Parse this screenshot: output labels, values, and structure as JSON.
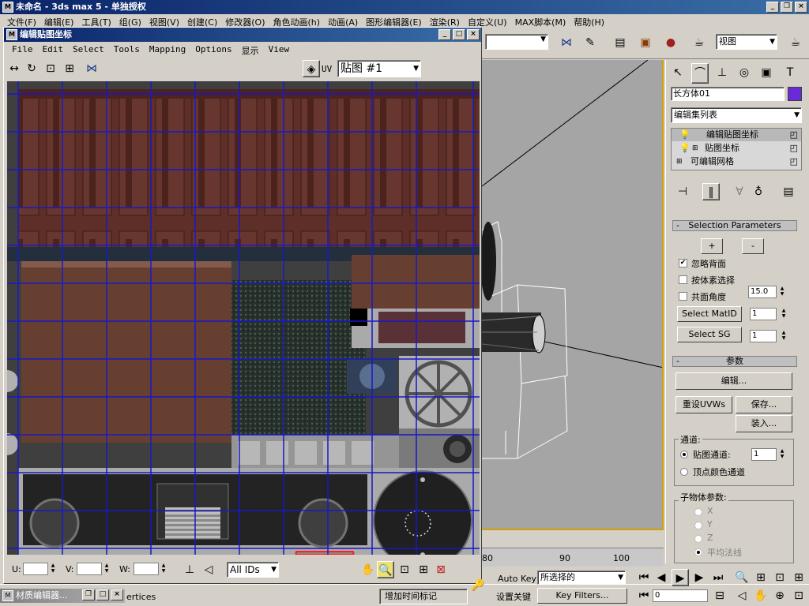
{
  "app": {
    "title": "未命名 - 3ds max 5 - 单独授权",
    "menu": [
      "文件(F)",
      "编辑(E)",
      "工具(T)",
      "组(G)",
      "视图(V)",
      "创建(C)",
      "修改器(O)",
      "角色动画(h)",
      "动画(A)",
      "图形编辑器(E)",
      "渲染(R)",
      "自定义(U)",
      "MAX脚本(M)",
      "帮助(H)"
    ]
  },
  "toolbar": {
    "view_dropdown": "视图"
  },
  "uvw_editor": {
    "title": "编辑贴图坐标",
    "menu": [
      "File",
      "Edit",
      "Select",
      "Tools",
      "Mapping",
      "Options",
      "显示",
      "View"
    ],
    "uv_label": "UV",
    "map_dropdown": "贴图 #1",
    "u_label": "U:",
    "v_label": "V:",
    "w_label": "W:",
    "ids_dropdown": "All IDs"
  },
  "command_panel": {
    "object_name": "长方体01",
    "modifier_list_label": "编辑集列表",
    "stack": [
      {
        "label": "编辑贴图坐标",
        "selected": true
      },
      {
        "label": "贴图坐标",
        "selected": false
      },
      {
        "label": "可编辑网格",
        "selected": false
      }
    ],
    "selection_params": {
      "title": "Selection Parameters",
      "plus": "+",
      "minus": "-",
      "ignore_backface": "忽略背面",
      "select_by_element": "按体素选择",
      "planar_angle": "共面角度",
      "planar_angle_value": "15.0",
      "select_matid": "Select MatID",
      "select_matid_value": "1",
      "select_sg": "Select SG",
      "select_sg_value": "1"
    },
    "params": {
      "title": "参数",
      "edit": "编辑...",
      "reset": "重设UVWs",
      "save": "保存...",
      "load": "装入...",
      "channel_group": "通道:",
      "map_channel": "贴图通道:",
      "map_channel_value": "1",
      "vertex_color": "顶点颜色通道",
      "subobj_group": "子物体参数:",
      "axis_x": "X",
      "axis_y": "Y",
      "axis_z": "Z",
      "avg_normals": "平均法线"
    },
    "minus_label": "-"
  },
  "timeline": {
    "ticks": [
      "80",
      "90",
      "100"
    ]
  },
  "status": {
    "material_editor": "材质编辑器...",
    "vertices": "ertices",
    "add_time_tag": "增加时间标记",
    "auto_key": "Auto Key",
    "selected": "所选择的",
    "set_key": "设置关键",
    "key_filters": "Key Filters...",
    "frame": "0"
  }
}
